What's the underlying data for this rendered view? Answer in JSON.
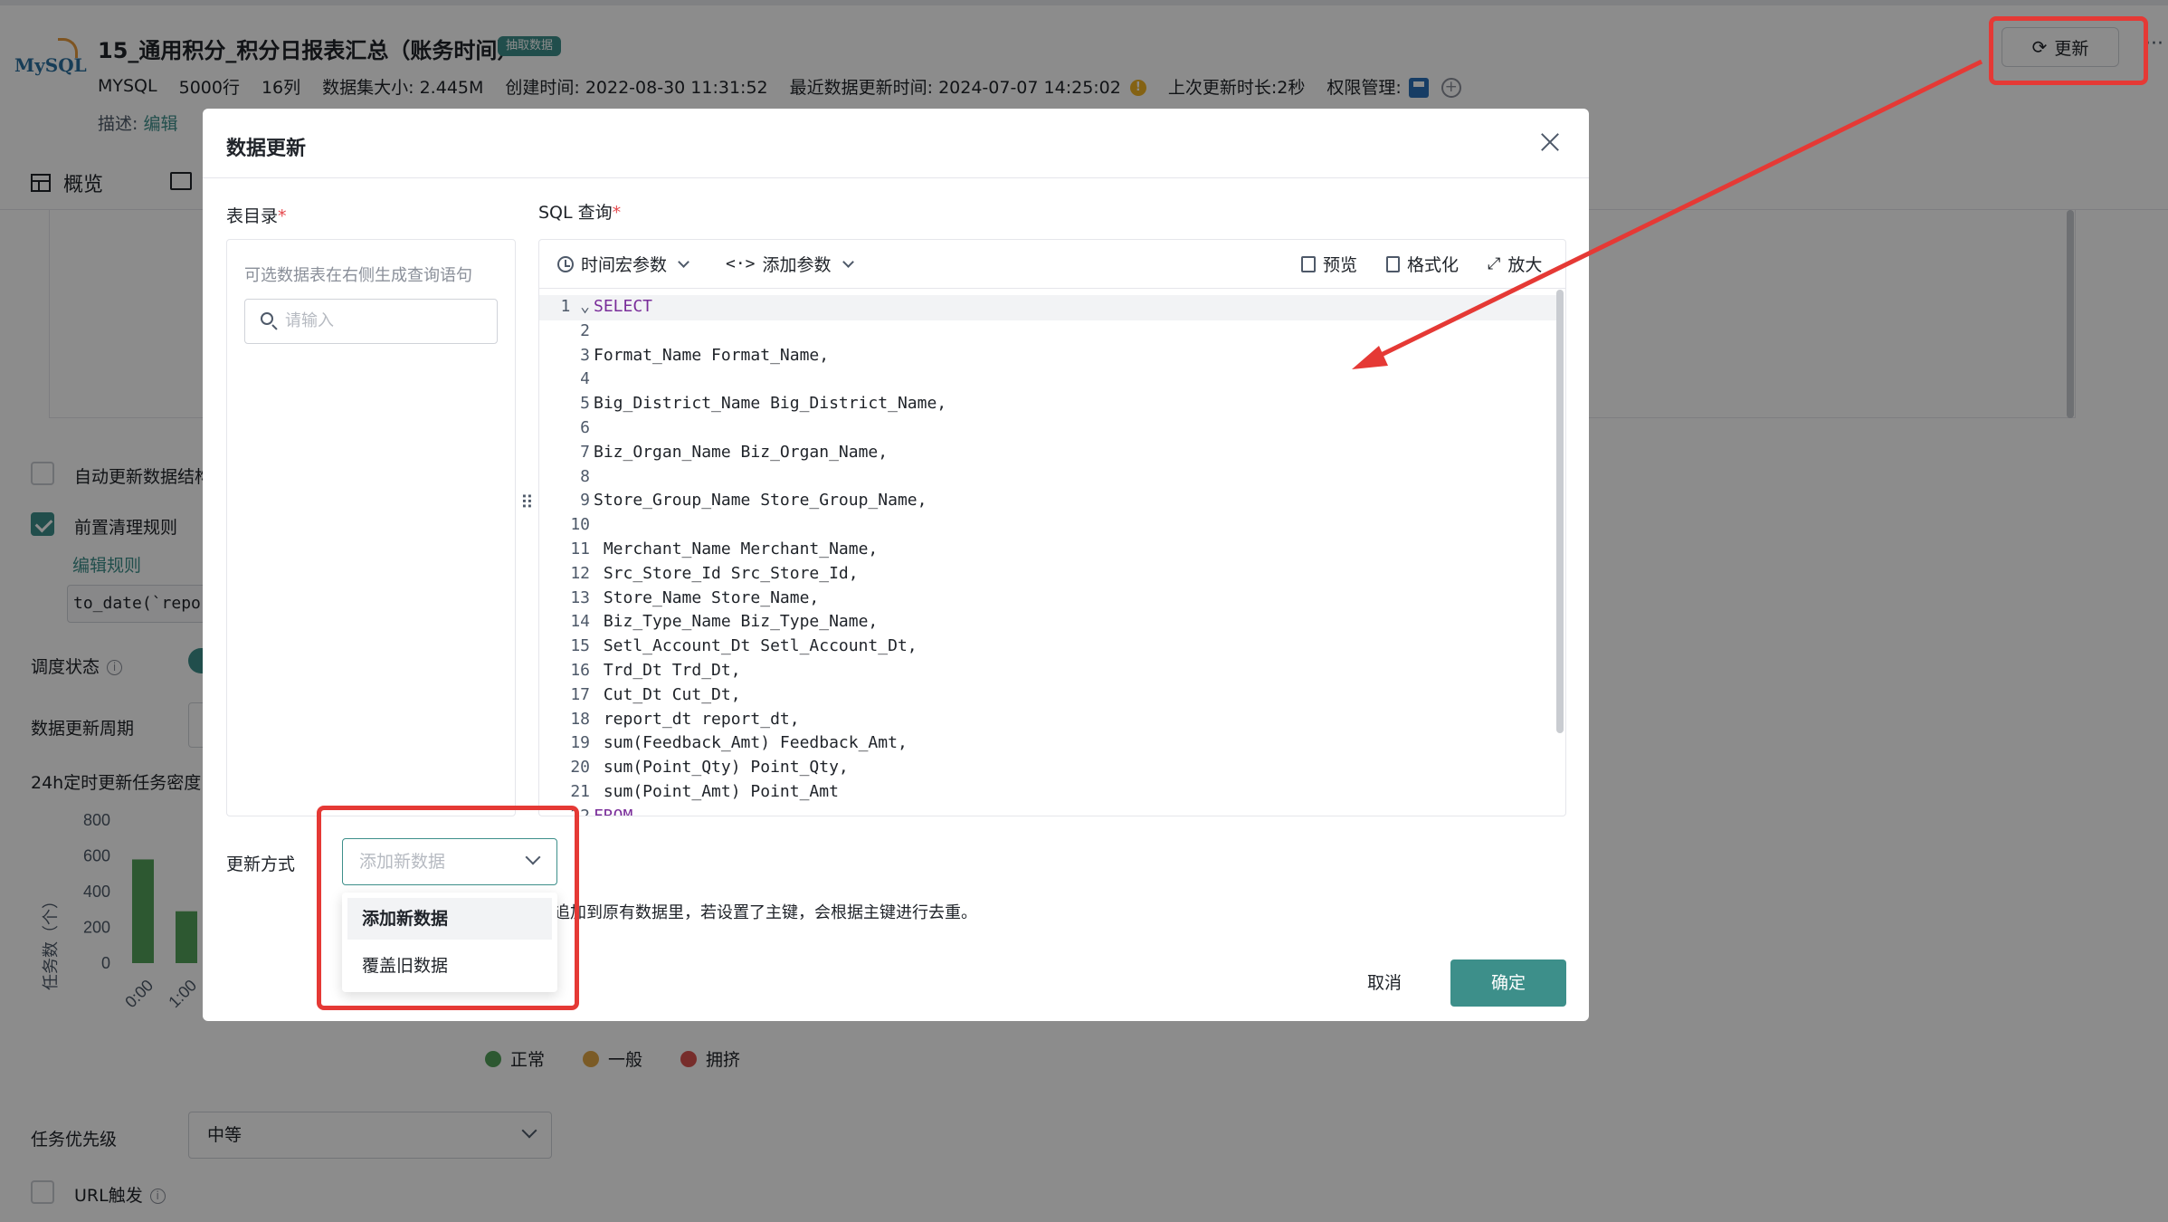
{
  "header": {
    "logo_text": "MySQL",
    "title": "15_通用积分_积分日报表汇总（账务时间）",
    "badge": "抽取数据",
    "meta": {
      "db_type": "MYSQL",
      "rows": "5000行",
      "cols": "16列",
      "size": "数据集大小: 2.445M",
      "created": "创建时间: 2022-08-30 11:31:52",
      "updated": "最近数据更新时间: 2024-07-07 14:25:02",
      "last_duration": "上次更新时长:2秒",
      "permission": "权限管理:"
    },
    "desc_label": "描述:",
    "desc_link": "编辑",
    "update_button": "更新",
    "more": "···"
  },
  "tabs": {
    "overview": "概览"
  },
  "settings": {
    "auto_update": "自动更新数据结构",
    "pre_clean": "前置清理规则",
    "edit_rule": "编辑规则",
    "rule_value": "to_date(`report_",
    "schedule_state": "调度状态",
    "update_period": "数据更新周期",
    "density_title": "24h定时更新任务密度",
    "chart_ylabel": "任务数（个）",
    "chart_ticks": [
      "800",
      "600",
      "400",
      "200",
      "0"
    ],
    "chart_xticks": [
      "0:00",
      "1:00"
    ],
    "legend": [
      "正常",
      "一般",
      "拥挤"
    ],
    "priority_label": "任务优先级",
    "priority_value": "中等",
    "url_trigger": "URL触发"
  },
  "chart_data": {
    "type": "bar",
    "categories": [
      "0:00",
      "1:00"
    ],
    "values": [
      580,
      290
    ],
    "ylabel": "任务数（个）",
    "ylim": [
      0,
      800
    ],
    "colors": {
      "normal": "#52a05a",
      "medium": "#e0a645",
      "busy": "#d9534f"
    }
  },
  "modal": {
    "title": "数据更新",
    "catalog_label": "表目录",
    "sql_label": "SQL 查询",
    "catalog_hint": "可选数据表在右侧生成查询语句",
    "search_placeholder": "请输入",
    "toolbar": {
      "time_macro": "时间宏参数",
      "add_param": "添加参数",
      "preview": "预览",
      "format": "格式化",
      "zoom": "放大"
    },
    "code_lines": [
      "SELECT",
      "",
      "Format_Name Format_Name,",
      "",
      "Big_District_Name Big_District_Name,",
      "",
      "Biz_Organ_Name Biz_Organ_Name,",
      "",
      "Store_Group_Name Store_Group_Name,",
      "",
      " Merchant_Name Merchant_Name,",
      " Src_Store_Id Src_Store_Id,",
      " Store_Name Store_Name,",
      " Biz_Type_Name Biz_Type_Name,",
      " Setl_Account_Dt Setl_Account_Dt,",
      " Trd_Dt Trd_Dt,",
      " Cut_Dt Cut_Dt,",
      " report_dt report_dt,",
      " sum(Feedback_Amt) Feedback_Amt,",
      " sum(Point_Qty) Point_Qty,",
      " sum(Point_Amt) Point_Amt",
      "FROM"
    ],
    "mode_label": "更新方式",
    "mode_placeholder": "添加新数据",
    "mode_desc": "追加到原有数据里，若设置了主键，会根据主键进行去重。",
    "mode_options": [
      "添加新数据",
      "覆盖旧数据"
    ],
    "cancel": "取消",
    "confirm": "确定"
  },
  "colors": {
    "accent": "#3d8f8a",
    "annotation": "#e53935"
  }
}
